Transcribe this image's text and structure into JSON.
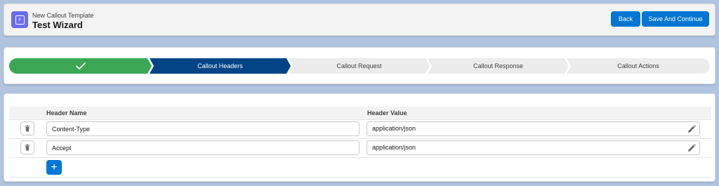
{
  "header": {
    "eyebrow": "New Callout Template",
    "title": "Test Wizard",
    "back_label": "Back",
    "save_label": "Save And Continue"
  },
  "path": {
    "steps": [
      {
        "label": "",
        "state": "complete"
      },
      {
        "label": "Callout Headers",
        "state": "current"
      },
      {
        "label": "Callout Request",
        "state": "incomplete"
      },
      {
        "label": "Callout Response",
        "state": "incomplete"
      },
      {
        "label": "Callout Actions",
        "state": "incomplete"
      }
    ]
  },
  "table": {
    "columns": [
      "Header Name",
      "Header Value"
    ],
    "rows": [
      {
        "name": "Content-Type",
        "value": "application/json"
      },
      {
        "name": "Accept",
        "value": "application/json"
      }
    ],
    "add_label": "+"
  },
  "colors": {
    "brand": "#0176d3",
    "path_complete": "#3ba755",
    "path_current": "#014486",
    "path_incomplete": "#ececec",
    "background": "#b0c4df",
    "app_icon": "#6a6ce8"
  },
  "icons": {
    "app": "wizard-icon",
    "complete": "check-icon",
    "delete": "trash-icon",
    "edit": "pencil-icon",
    "add": "plus-icon"
  }
}
